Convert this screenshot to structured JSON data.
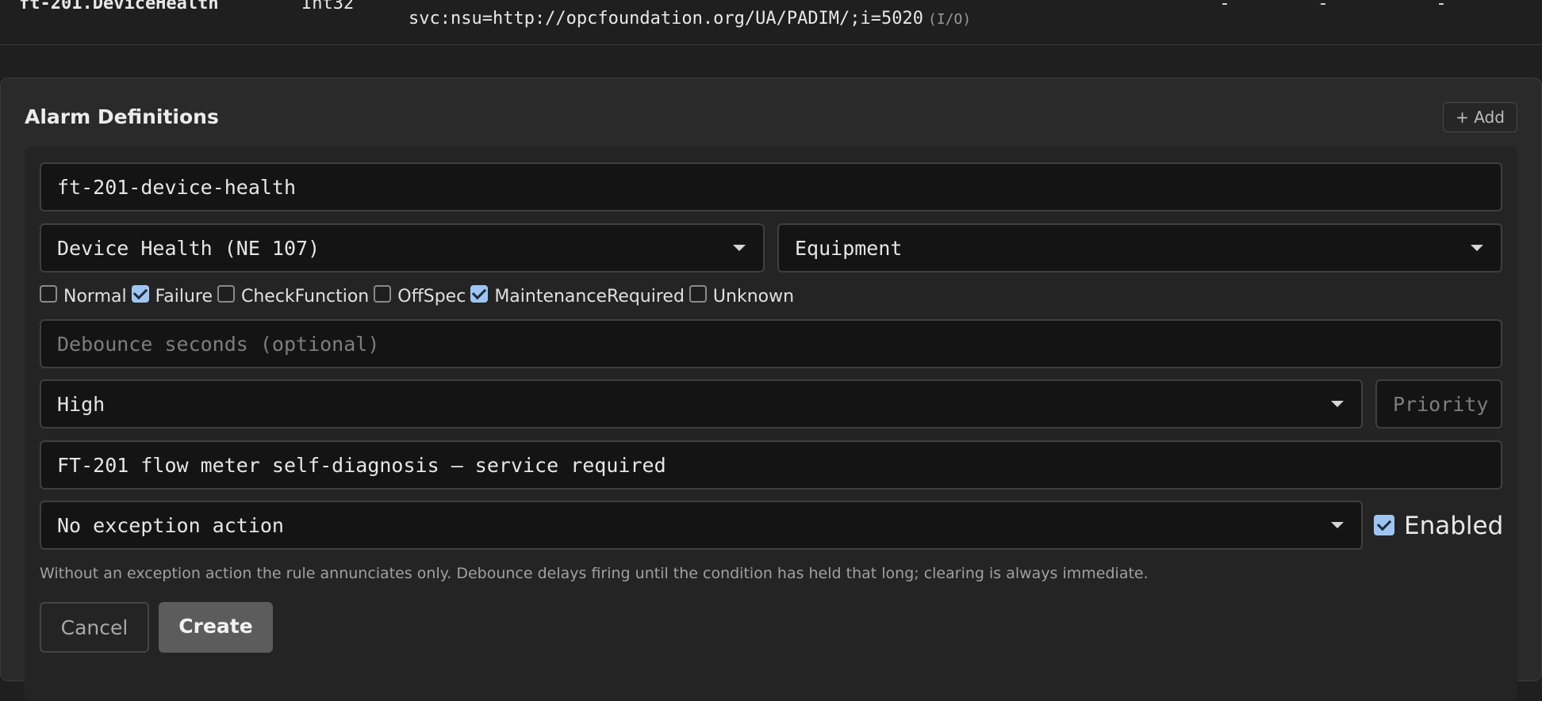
{
  "table_row": {
    "name": "ft-201.DeviceHealth",
    "type": "Int32",
    "address": "svc:nsu=http://opcfoundation.org/UA/PADIM/;i=5020",
    "access": "(I/O)",
    "col_a": "-",
    "col_b": "-",
    "col_c": "-"
  },
  "panel": {
    "title": "Alarm Definitions",
    "add_label": "+ Add"
  },
  "form": {
    "rule_id": "ft-201-device-health",
    "kind_selected": "Device Health (NE 107)",
    "category_selected": "Equipment",
    "states": [
      {
        "label": "Normal",
        "checked": false
      },
      {
        "label": "Failure",
        "checked": true
      },
      {
        "label": "CheckFunction",
        "checked": false
      },
      {
        "label": "OffSpec",
        "checked": false
      },
      {
        "label": "MaintenanceRequired",
        "checked": true
      },
      {
        "label": "Unknown",
        "checked": false
      }
    ],
    "debounce_placeholder": "Debounce seconds (optional)",
    "severity_selected": "High",
    "priority_placeholder": "Priority",
    "message": "FT-201 flow meter self-diagnosis — service required",
    "exception_action_selected": "No exception action",
    "enabled_label": "Enabled",
    "enabled_checked": true,
    "hint": "Without an exception action the rule annunciates only. Debounce delays firing until the condition has held that long; clearing is always immediate.",
    "cancel_label": "Cancel",
    "create_label": "Create"
  },
  "colors": {
    "background": "#1f1f1f",
    "panel": "#2a2a2a",
    "field": "#141414",
    "checkbox_accent": "#9fc6f2"
  },
  "icons": {
    "dropdown": "chevron-down-icon",
    "checkbox": "checkmark-icon"
  }
}
